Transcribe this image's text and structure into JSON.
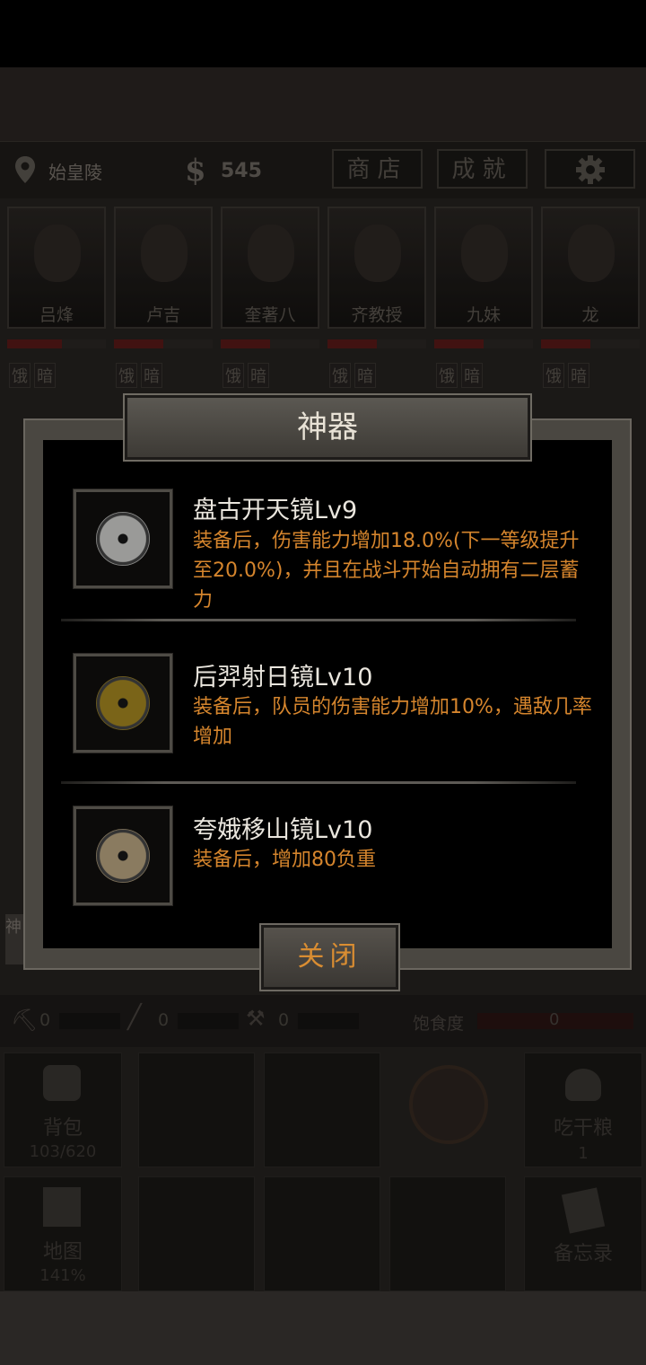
{
  "status": {
    "location": "始皇陵",
    "money_symbol": "$",
    "money": "545",
    "shop_label": "商店",
    "achievements_label": "成就"
  },
  "team": [
    {
      "name": "吕烽",
      "hp": 0.55,
      "tags": [
        "饿",
        "暗"
      ]
    },
    {
      "name": "卢吉",
      "hp": 0.5,
      "tags": [
        "饿",
        "暗"
      ]
    },
    {
      "name": "奎著八",
      "hp": 0.5,
      "tags": [
        "饿",
        "暗"
      ]
    },
    {
      "name": "齐教授",
      "hp": 0.5,
      "tags": [
        "饿",
        "暗"
      ]
    },
    {
      "name": "九妹",
      "hp": 0.5,
      "tags": [
        "饿",
        "暗"
      ]
    },
    {
      "name": "龙",
      "hp": 0.5,
      "tags": [
        "饿",
        "暗"
      ]
    }
  ],
  "dialog": {
    "title": "神器",
    "items": [
      {
        "name": "盘古开天镜Lv9",
        "desc": "装备后，伤害能力增加18.0%(下一等级提升至20.0%)，并且在战斗开始自动拥有二层蓄力",
        "color": "#9a9a98"
      },
      {
        "name": "后羿射日镜Lv10",
        "desc": "装备后，队员的伤害能力增加10%，遇敌几率增加",
        "color": "#7a6418"
      },
      {
        "name": "夸娥移山镜Lv10",
        "desc": "装备后，增加80负重",
        "color": "#8a7b60"
      }
    ],
    "close_label": "关闭"
  },
  "side_tab": "神",
  "tools": {
    "pickaxe": "0",
    "rope": "0",
    "shovel": "0",
    "satiety_label": "饱食度",
    "satiety": "0"
  },
  "grid": {
    "backpack_label": "背包",
    "backpack_count": "103/620",
    "eat_label": "吃干粮",
    "eat_count": "1",
    "map_label": "地图",
    "map_percent": "141%",
    "memo_label": "备忘录"
  },
  "colors": {
    "accent_orange": "#d5852d",
    "dialog_title_text": "#e8e2d6",
    "hp_red": "#5a1a18"
  }
}
